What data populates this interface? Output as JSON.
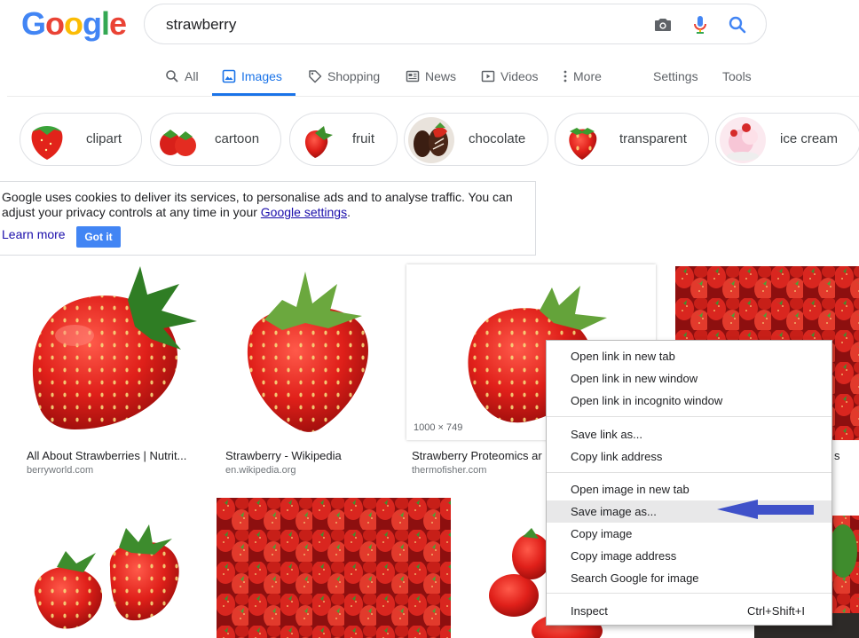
{
  "header": {
    "logo_letters": [
      {
        "ch": "G",
        "color": "#4285f4"
      },
      {
        "ch": "o",
        "color": "#ea4335"
      },
      {
        "ch": "o",
        "color": "#fbbc05"
      },
      {
        "ch": "g",
        "color": "#4285f4"
      },
      {
        "ch": "l",
        "color": "#34a853"
      },
      {
        "ch": "e",
        "color": "#ea4335"
      }
    ],
    "search_value": "strawberry",
    "icons": [
      "camera-icon",
      "microphone-icon",
      "search-icon"
    ]
  },
  "tabs": {
    "all": "All",
    "images": "Images",
    "shopping": "Shopping",
    "news": "News",
    "videos": "Videos",
    "more": "More",
    "settings": "Settings",
    "tools": "Tools",
    "active": "images"
  },
  "chips": {
    "clipart": "clipart",
    "cartoon": "cartoon",
    "fruit": "fruit",
    "chocolate": "chocolate",
    "transparent": "transparent",
    "ice_cream": "ice cream"
  },
  "cookie": {
    "line1": "Google uses cookies to deliver its services, to personalise ads and to analyse traffic. You can",
    "line2_prefix": "adjust your privacy controls at any time in your ",
    "settings_link": "Google settings",
    "line2_suffix": ".",
    "learn_more": "Learn more",
    "got_it": "Got it"
  },
  "results": {
    "r1": {
      "title": "All About Strawberries | Nutrit...",
      "domain": "berryworld.com"
    },
    "r2": {
      "title": "Strawberry - Wikipedia",
      "domain": "en.wikipedia.org"
    },
    "r3": {
      "title": "Strawberry Proteomics ar",
      "domain": "thermofisher.com",
      "dimensions": "1000 × 749"
    },
    "r4": {
      "title_fragment": "s"
    }
  },
  "context_menu": {
    "open_new_tab": "Open link in new tab",
    "open_new_window": "Open link in new window",
    "open_incognito": "Open link in incognito window",
    "save_link": "Save link as...",
    "copy_link": "Copy link address",
    "open_image_tab": "Open image in new tab",
    "save_image": "Save image as...",
    "copy_image": "Copy image",
    "copy_image_address": "Copy image address",
    "search_google_image": "Search Google for image",
    "inspect": "Inspect",
    "inspect_shortcut": "Ctrl+Shift+I",
    "highlighted": "save_image"
  },
  "colors": {
    "accent": "#1a73e8",
    "annotation_arrow": "#3f51c9",
    "got_it_button": "#4285f4"
  }
}
